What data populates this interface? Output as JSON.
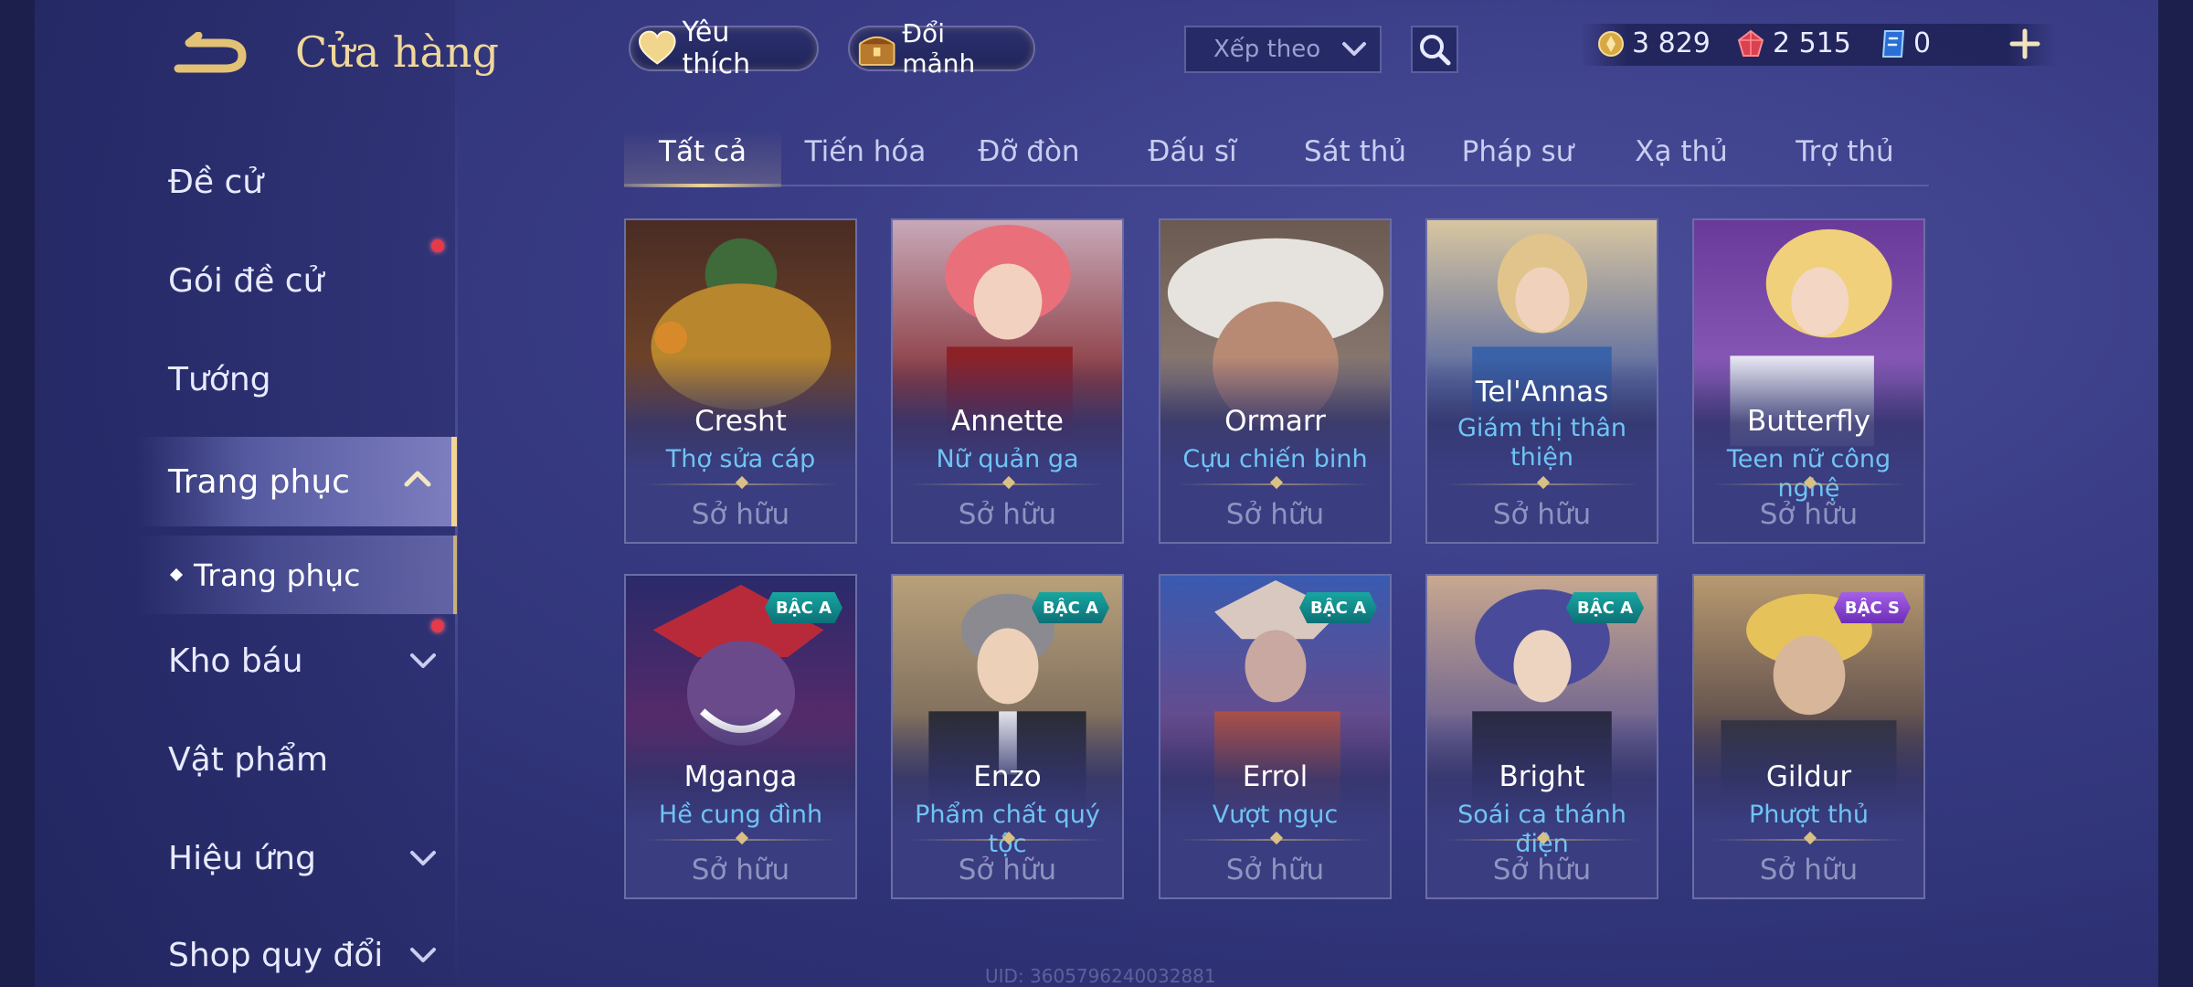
{
  "header": {
    "title": "Cửa hàng",
    "favorites_label": "Yêu thích",
    "fragments_label": "Đổi mảnh",
    "sort_placeholder": "Xếp theo",
    "currencies": [
      {
        "icon": "gold-coin-icon",
        "value": "3 829"
      },
      {
        "icon": "red-gem-icon",
        "value": "2 515"
      },
      {
        "icon": "voucher-icon",
        "value": "0"
      }
    ]
  },
  "sidebar": {
    "items": [
      {
        "label": "Đề cử"
      },
      {
        "label": "Gói đề cử"
      },
      {
        "label": "Tướng"
      },
      {
        "label": "Trang phục"
      },
      {
        "label": "Kho báu"
      },
      {
        "label": "Vật phẩm"
      },
      {
        "label": "Hiệu ứng"
      },
      {
        "label": "Shop quy đổi"
      }
    ],
    "sub_item": "Trang phục"
  },
  "tabs": [
    "Tất cả",
    "Tiến hóa",
    "Đỡ đòn",
    "Đấu sĩ",
    "Sát thủ",
    "Pháp sư",
    "Xạ thủ",
    "Trợ thủ"
  ],
  "cards": [
    {
      "hero": "Cresht",
      "skin": "Thợ sửa cáp",
      "status": "Sở hữu",
      "rank": ""
    },
    {
      "hero": "Annette",
      "skin": "Nữ quản ga",
      "status": "Sở hữu",
      "rank": ""
    },
    {
      "hero": "Ormarr",
      "skin": "Cựu chiến binh",
      "status": "Sở hữu",
      "rank": ""
    },
    {
      "hero": "Tel'Annas",
      "skin": "Giám thị thân thiện",
      "status": "Sở hữu",
      "rank": ""
    },
    {
      "hero": "Butterfly",
      "skin": "Teen nữ công nghệ",
      "status": "Sở hữu",
      "rank": ""
    },
    {
      "hero": "Mganga",
      "skin": "Hề cung đình",
      "status": "Sở hữu",
      "rank": "BẬC A"
    },
    {
      "hero": "Enzo",
      "skin": "Phẩm chất quý tộc",
      "status": "Sở hữu",
      "rank": "BẬC A"
    },
    {
      "hero": "Errol",
      "skin": "Vượt ngục",
      "status": "Sở hữu",
      "rank": "BẬC A"
    },
    {
      "hero": "Bright",
      "skin": "Soái ca thánh điện",
      "status": "Sở hữu",
      "rank": "BẬC A"
    },
    {
      "hero": "Gildur",
      "skin": "Phượt thủ",
      "status": "Sở hữu",
      "rank": "BẬC S"
    }
  ],
  "uid": "UID: 3605796240032881",
  "colors": {
    "accent_gold": "#f0d594",
    "skin_name": "#6fc4f5",
    "rank_a": "#19a6a0",
    "rank_s": "#a561e6",
    "notification": "#e43a4a"
  }
}
